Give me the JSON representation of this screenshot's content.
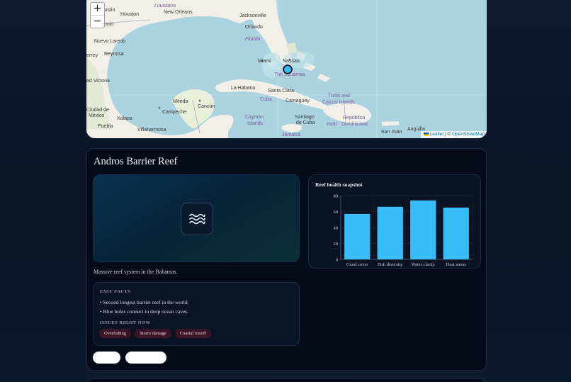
{
  "map": {
    "zoom_in": "+",
    "zoom_out": "−",
    "labels": {
      "austin": "Austin",
      "houston": "Houston",
      "louisiana": "Louisiana",
      "new_orleans": "New Orleans",
      "jacksonville": "Jacksonville",
      "orlando": "Orlando",
      "florida": "Florida",
      "tonio": "tonio",
      "nuevo_laredo": "Nuevo Laredo",
      "reynosa": "Reynosa",
      "errey": "errey",
      "miami": "Miami",
      "nassau": "Nassau",
      "the_bahamas": "The Bahamas",
      "victoria": "ad Victoria",
      "la_habana": "La Habana",
      "santa_clara": "Santa Clara",
      "cuba": "Cuba",
      "camaguey": "Camagüey",
      "turks": "Turks and",
      "caicos": "Caicos Islands",
      "merida": "Mérida",
      "cancun": "Cancún",
      "campeche": "Campeche",
      "ciudad_de_mexico": "Ciudad de",
      "mexico": "México",
      "xalapa": "Xalapa",
      "puebla": "Puebla",
      "villahermosa": "Villahermosa",
      "cayman": "Cayman",
      "islands": "Islands",
      "santiago": "Santiago",
      "de_cuba": "de Cuba",
      "haiti": "Haïti",
      "republica": "República",
      "dominicana": "Dominicana",
      "san_juan": "San Juan",
      "anguilla": "Anguilla",
      "jamaica": "Jamaica"
    },
    "attribution": {
      "leaflet": "Leaflet",
      "separator": "| ©",
      "osm": "OpenStreetMap"
    }
  },
  "reef": {
    "title": "Andros Barrier Reef",
    "hero_icon": "waves-icon",
    "description": "Massive reef system in the Bahamas.",
    "fast_facts_heading": "FAST FACTS",
    "facts": [
      "• Second longest barrier reef in the world.",
      "• Blue holes connect to deep ocean caves."
    ],
    "issues_heading": "ISSUES RIGHT NOW",
    "issues": [
      "Overfishing",
      "Storm damage",
      "Coastal runoff"
    ],
    "buttons": [
      "",
      ""
    ]
  },
  "chart_data": {
    "type": "bar",
    "title": "Reef health snapshot",
    "categories": [
      "Coral cover",
      "Fish diversity",
      "Water clarity",
      "Heat stress"
    ],
    "values": [
      57,
      66,
      74,
      65
    ],
    "ylim": [
      0,
      80
    ],
    "yticks": [
      0,
      20,
      40,
      60,
      80
    ],
    "color": "#38bdf8",
    "grid": true
  },
  "colors": {
    "bar": "#38bdf8",
    "tag_bg": "#3b1427",
    "card_bg": "#050b18"
  }
}
